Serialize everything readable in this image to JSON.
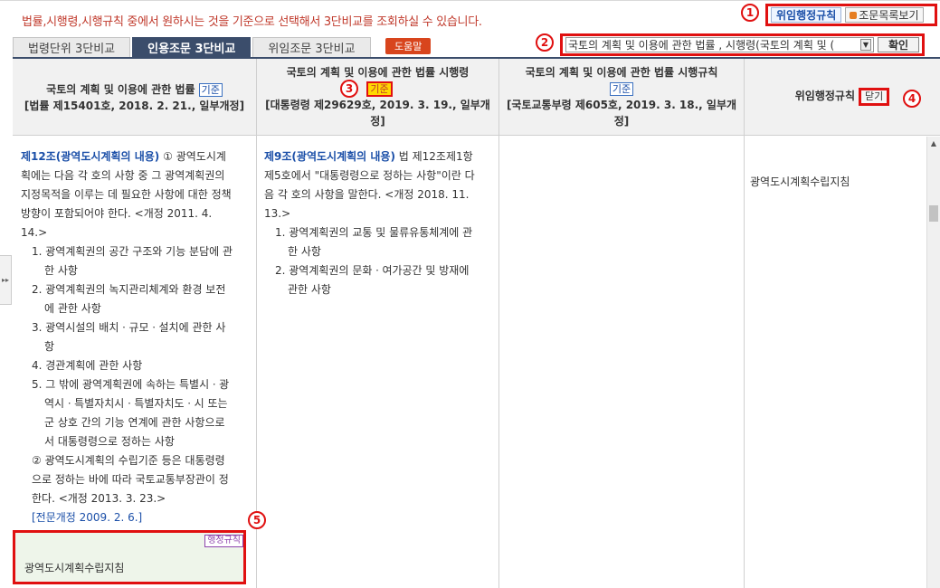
{
  "notice": "법률,시행령,시행규칙 중에서 원하시는 것을 기준으로 선택해서 3단비교를 조회하실 수 있습니다.",
  "top_buttons": {
    "admin_rules": "위임행정규칙",
    "article_list": "조문목록보기"
  },
  "tabs": [
    {
      "label": "법령단위 3단비교"
    },
    {
      "label": "인용조문 3단비교"
    },
    {
      "label": "위임조문 3단비교"
    }
  ],
  "help_label": "도움말",
  "selector": {
    "value": "국토의 계획 및 이용에 관한 법률 , 시행령(국토의 계획 및 (",
    "confirm": "확인"
  },
  "columns": [
    {
      "title": "국토의 계획 및 이용에 관한 법률",
      "badge": "기준",
      "info": "[법률 제15401호, 2018. 2. 21., 일부개정]"
    },
    {
      "title": "국토의 계획 및 이용에 관한 법률 시행령",
      "badge": "기준",
      "info": "[대통령령 제29629호, 2019. 3. 19., 일부개정]"
    },
    {
      "title": "국토의 계획 및 이용에 관한 법률 시행규칙",
      "badge": "기준",
      "info": "[국토교통부령 제605호, 2019. 3. 18., 일부개정]"
    },
    {
      "title": "위임행정규칙",
      "close": "닫기"
    }
  ],
  "markers": [
    "1",
    "2",
    "3",
    "4",
    "5"
  ],
  "law_article": {
    "title": "제12조(광역도시계획의 내용)",
    "intro": "① 광역도시계획에는 다음 각 호의 사항 중 그 광역계획권의 지정목적을 이루는 데 필요한 사항에 대한 정책 방향이 포함되어야 한다. <개정 2011. 4. 14.>",
    "items": [
      "1. 광역계획권의 공간 구조와 기능 분담에 관한 사항",
      "2. 광역계획권의 녹지관리체계와 환경 보전에 관한 사항",
      "3. 광역시설의 배치ㆍ규모ㆍ설치에 관한 사항",
      "4. 경관계획에 관한 사항",
      "5. 그 밖에 광역계획권에 속하는 특별시ㆍ광역시ㆍ특별자치시ㆍ특별자치도ㆍ시 또는 군 상호 간의 기능 연계에 관한 사항으로서 대통령령으로 정하는 사항"
    ],
    "para2": "② 광역도시계획의 수립기준 등은 대통령령으로 정하는 바에 따라 국토교통부장관이 정한다. <개정 2013. 3. 23.>",
    "revision": "[전문개정 2009. 2. 6.]"
  },
  "decree_article": {
    "title": "제9조(광역도시계획의 내용)",
    "intro": "법 제12조제1항제5호에서 \"대통령령으로 정하는 사항\"이란 다음 각 호의 사항을 말한다. <개정 2018. 11. 13.>",
    "items": [
      "1. 광역계획권의 교통 및 물류유통체계에 관한 사항",
      "2. 광역계획권의 문화ㆍ여가공간 및 방재에 관한 사항"
    ]
  },
  "admin_rule_text": "광역도시계획수립지침",
  "admin_box": {
    "tag": "행정규칙",
    "text": "광역도시계획수립지침"
  }
}
